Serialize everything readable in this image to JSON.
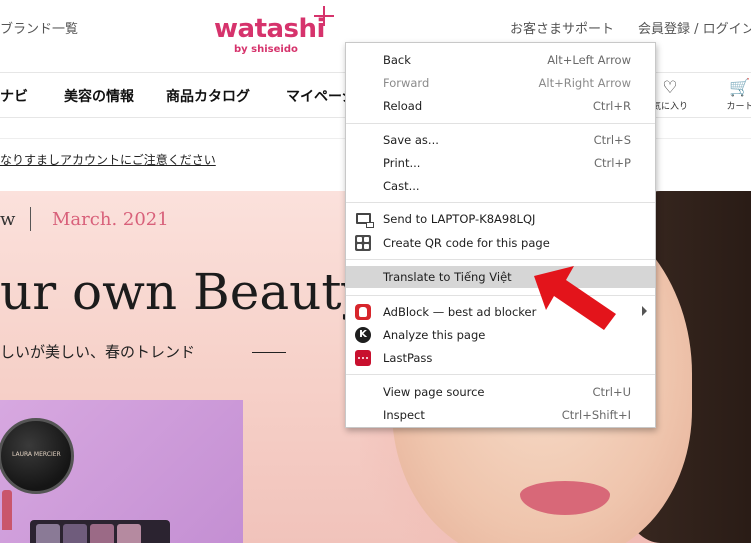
{
  "site": {
    "header": {
      "brands_link": "ブランド一覧",
      "logo_word": "watashi",
      "logo_sub": "by shiseido",
      "support_link": "お客さまサポート",
      "register_link": "会員登録 / ログイン"
    },
    "nav": {
      "items": [
        "ナビ",
        "美容の情報",
        "商品カタログ",
        "マイページ"
      ],
      "favorites_label": "気に入り",
      "cart_label": "カート"
    },
    "notice": {
      "link": "なりすましアカウントにご注意ください"
    },
    "hero": {
      "issue_prefix": "w",
      "issue_date": "March. 2021",
      "title": "ur own Beauty",
      "subtitle": "しいが美しい、春のトレンド",
      "product_label": "LAURA MERCIER"
    }
  },
  "context_menu": {
    "sections": [
      [
        {
          "label": "Back",
          "shortcut": "Alt+Left Arrow",
          "disabled": false
        },
        {
          "label": "Forward",
          "shortcut": "Alt+Right Arrow",
          "disabled": true
        },
        {
          "label": "Reload",
          "shortcut": "Ctrl+R",
          "disabled": false
        }
      ],
      [
        {
          "label": "Save as...",
          "shortcut": "Ctrl+S"
        },
        {
          "label": "Print...",
          "shortcut": "Ctrl+P"
        },
        {
          "label": "Cast..."
        }
      ],
      [
        {
          "label": "Send to LAPTOP-K8A98LQJ",
          "icon": "monitor-icon"
        },
        {
          "label": "Create QR code for this page",
          "icon": "qr-code-icon"
        }
      ],
      [
        {
          "label": "Translate to Tiếng Việt",
          "highlighted": true
        }
      ],
      [
        {
          "label": "AdBlock — best ad blocker",
          "icon": "adblock-icon",
          "submenu": true
        },
        {
          "label": "Analyze this page",
          "icon": "analyze-icon",
          "icon_letter": "K"
        },
        {
          "label": "LastPass",
          "icon": "lastpass-icon"
        }
      ],
      [
        {
          "label": "View page source",
          "shortcut": "Ctrl+U"
        },
        {
          "label": "Inspect",
          "shortcut": "Ctrl+Shift+I"
        }
      ]
    ]
  },
  "colors": {
    "brand": "#d6336c",
    "issue_date": "#d8607a",
    "annotation_arrow": "#e3141b",
    "menu_highlight": "#d6d6d6"
  }
}
